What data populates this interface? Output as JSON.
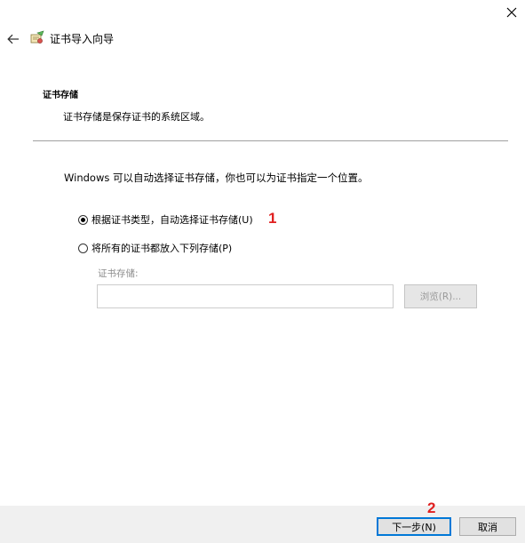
{
  "titlebar": {
    "close_symbol": "✕"
  },
  "header": {
    "back_symbol": "←",
    "title": "证书导入向导",
    "icon": "certificate-wizard-icon"
  },
  "section": {
    "heading": "证书存储",
    "description": "证书存储是保存证书的系统区域。"
  },
  "main": {
    "intro": "Windows 可以自动选择证书存储，你也可以为证书指定一个位置。",
    "options": [
      {
        "label": "根据证书类型，自动选择证书存储(U)",
        "selected": true
      },
      {
        "label": "将所有的证书都放入下列存储(P)",
        "selected": false
      }
    ],
    "store_label": "证书存储:",
    "store_value": "",
    "browse_label": "浏览(R)..."
  },
  "annotations": {
    "one": "1",
    "two": "2",
    "color": "#e02020"
  },
  "footer": {
    "next_label": "下一步(N)",
    "cancel_label": "取消"
  },
  "colors": {
    "accent": "#0078d7",
    "footer_bg": "#f0f0f0",
    "disabled_text": "#8c8c8c"
  }
}
